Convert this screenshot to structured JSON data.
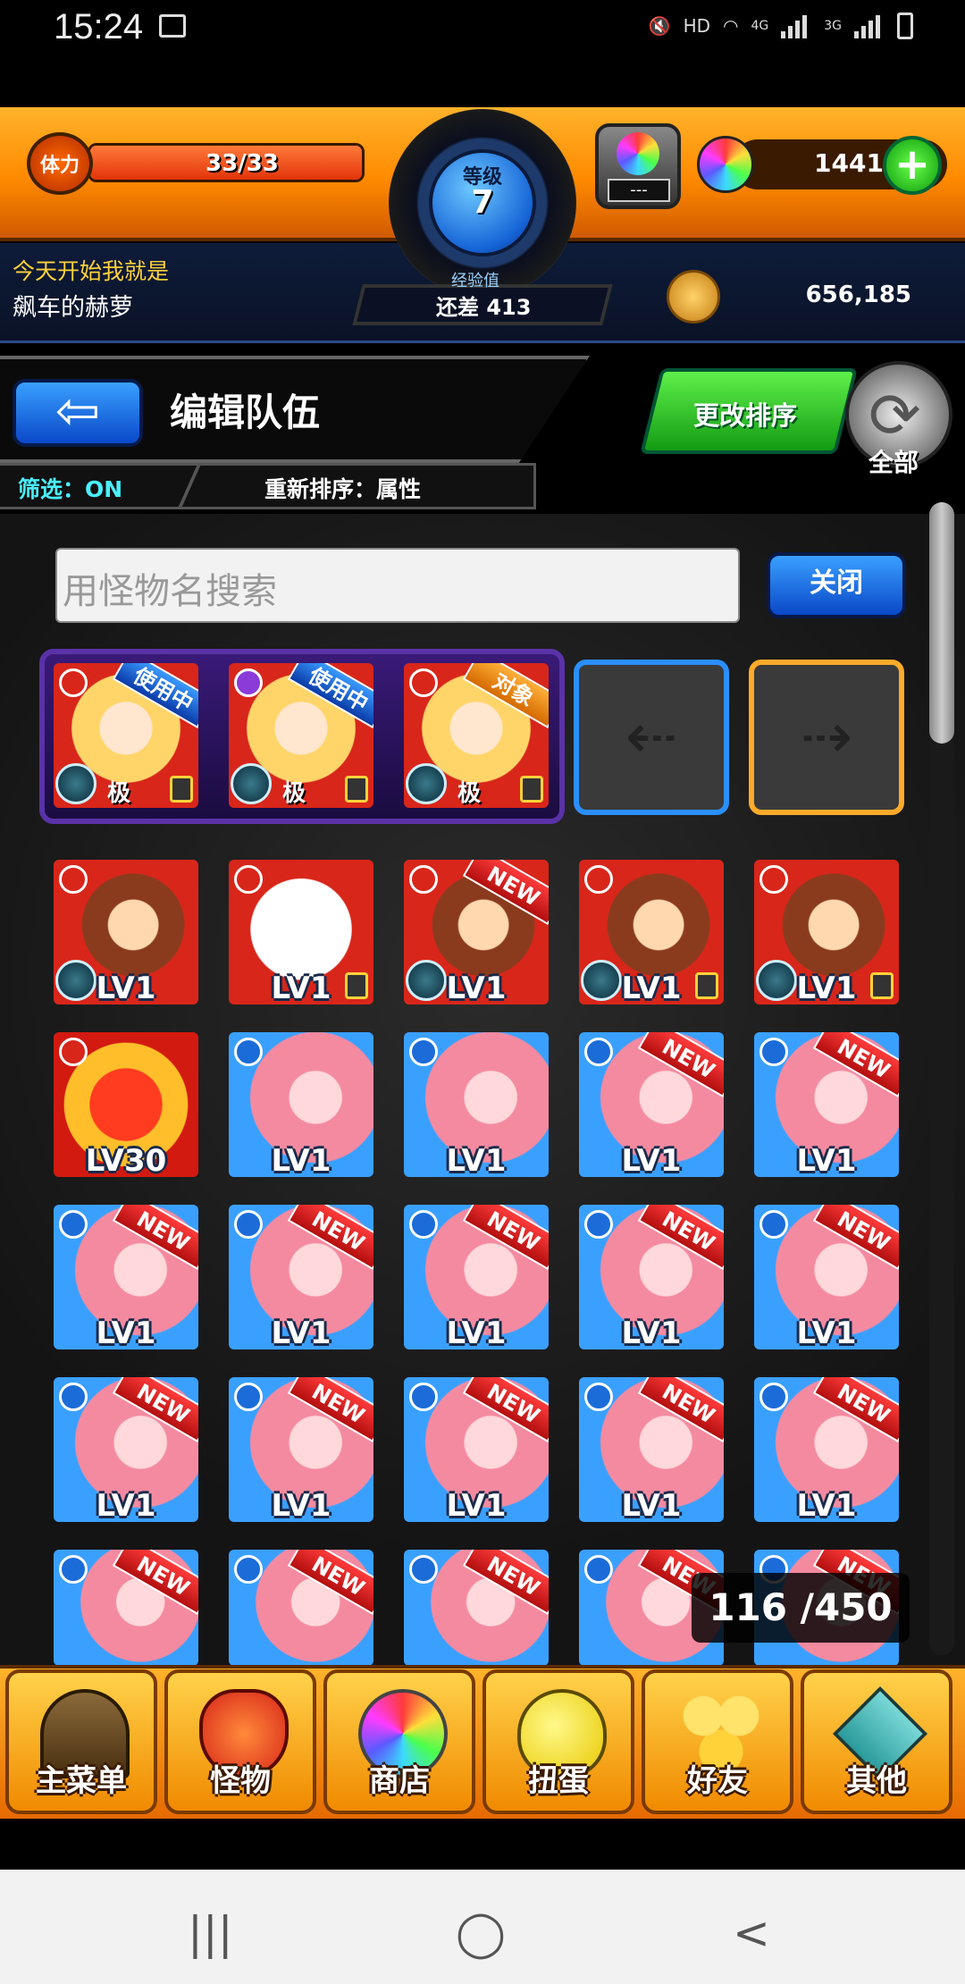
{
  "status_bar": {
    "time": "15:24",
    "network": "HD",
    "net1": "4G",
    "net2": "3G"
  },
  "header": {
    "stamina_label": "体力",
    "stamina_value": "33/33",
    "stamina_fraction": 1.0,
    "level_label": "等级",
    "level_value": "7",
    "gem_box_label": "---",
    "orbs": "1441",
    "plus": "+",
    "message_line1": "今天开始我就是",
    "message_line2": "飙车的赫萝",
    "exp_label": "经验值",
    "exp_value": "还差 413",
    "coins": "656,185"
  },
  "title_bar": {
    "back": "⇦",
    "title": "编辑队伍",
    "filter": "筛选：ON",
    "sort": "重新排序：属性",
    "change_order": "更改排序",
    "all": "全部"
  },
  "search": {
    "placeholder": "用怪物名搜索",
    "close": "关闭"
  },
  "team": [
    {
      "tag": "使用中",
      "rank": "极"
    },
    {
      "tag": "使用中",
      "rank": "极"
    },
    {
      "tag": "对象",
      "rank": "极"
    }
  ],
  "grid_rows": [
    [
      "LV1",
      "LV1",
      "LV1",
      "LV1",
      "LV1"
    ],
    [
      "LV30",
      "LV1",
      "LV1",
      "LV1",
      "LV1"
    ],
    [
      "LV1",
      "LV1",
      "LV1",
      "LV1",
      "LV1"
    ],
    [
      "LV1",
      "LV1",
      "LV1",
      "LV1",
      "LV1"
    ],
    [
      "",
      "",
      "",
      "",
      ""
    ]
  ],
  "new_badge": "NEW",
  "box_count": "116 /450",
  "bottom_nav": [
    {
      "label": "主菜单",
      "icon": "gate-icon"
    },
    {
      "label": "怪物",
      "icon": "monster-icon"
    },
    {
      "label": "商店",
      "icon": "rainbow-orb-icon"
    },
    {
      "label": "扭蛋",
      "icon": "gacha-egg-icon"
    },
    {
      "label": "好友",
      "icon": "friends-icon"
    },
    {
      "label": "其他",
      "icon": "question-icon"
    }
  ],
  "system_nav": {
    "recent": "|||",
    "home": "◯",
    "back": "<"
  }
}
